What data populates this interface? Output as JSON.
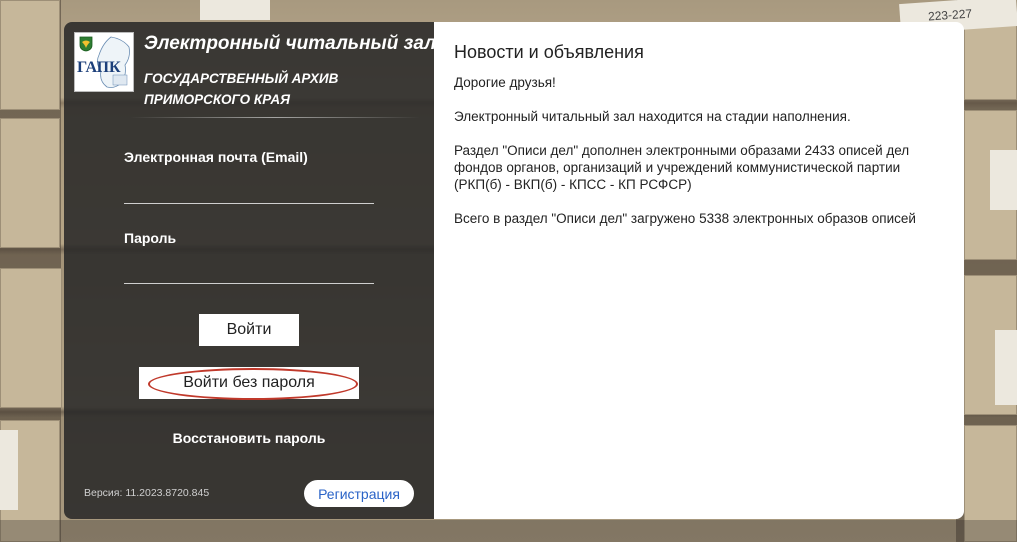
{
  "header": {
    "logo_abbr": "ГАПК",
    "title": "Электронный читальный зал",
    "subtitle": "Государственный архив Приморского края"
  },
  "login": {
    "email_label": "Электронная почта (Email)",
    "email_value": "",
    "password_label": "Пароль",
    "password_value": "",
    "login_button": "Войти",
    "login_no_password_button": "Войти без пароля",
    "restore_password_link": "Восстановить пароль",
    "version": "Версия: 11.2023.8720.845",
    "register_button": "Регистрация"
  },
  "news": {
    "title": "Новости и объявления",
    "paragraphs": [
      "Дорогие друзья!",
      "Электронный читальный зал находится на стадии наполнения.",
      "Раздел \"Описи дел\" дополнен электронными образами 2433 описей дел фондов органов, организаций и учреждений коммунистической партии (РКП(б) - ВКП(б) - КПСС - КП РСФСР)",
      "Всего в раздел \"Описи дел\" загружено 5338 электронных образов описей"
    ]
  },
  "background": {
    "shelf_label": "223-227"
  },
  "colors": {
    "panel_dark": "#262626",
    "link_blue": "#2a63c7",
    "highlight_oval": "#c0392b"
  },
  "icons": {
    "logo": "region-crest-map-icon"
  }
}
